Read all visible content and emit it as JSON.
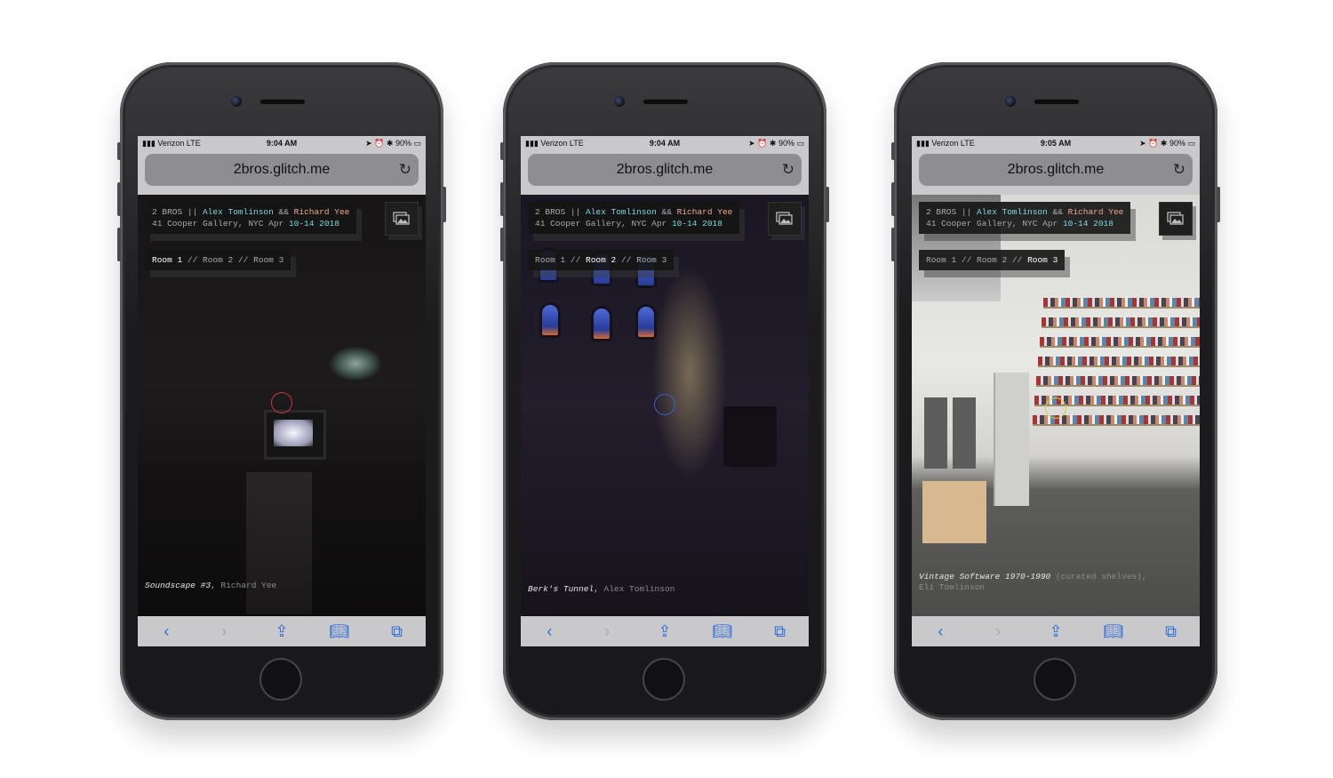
{
  "phones": [
    {
      "status": {
        "carrier": "Verizon",
        "network": "LTE",
        "time": "9:04 AM",
        "battery": "90%"
      },
      "url": "2bros.glitch.me",
      "info": {
        "prefix": "2 BROS || ",
        "artist1": "Alex Tomlinson",
        "amp": " && ",
        "artist2": "Richard Yee",
        "venue": "41 Cooper Gallery, NYC Apr ",
        "dates": "10-14 2018"
      },
      "rooms": {
        "r1": "Room 1",
        "sep1": " // ",
        "r2": "Room 2",
        "sep2": " // ",
        "r3": "Room 3",
        "active": 1
      },
      "caption": {
        "title": "Soundscape #3",
        "sep": ", ",
        "artist": "Richard Yee"
      },
      "reticle_color": "#d0343a"
    },
    {
      "status": {
        "carrier": "Verizon",
        "network": "LTE",
        "time": "9:04 AM",
        "battery": "90%"
      },
      "url": "2bros.glitch.me",
      "info": {
        "prefix": "2 BROS || ",
        "artist1": "Alex Tomlinson",
        "amp": " && ",
        "artist2": "Richard Yee",
        "venue": "41 Cooper Gallery, NYC Apr ",
        "dates": "10-14 2018"
      },
      "rooms": {
        "r1": "Room 1",
        "sep1": " // ",
        "r2": "Room 2",
        "sep2": " // ",
        "r3": "Room 3",
        "active": 2
      },
      "caption": {
        "title": "Berk's Tunnel",
        "sep": ", ",
        "artist": "Alex Tomlinson"
      },
      "reticle_color": "#3e5fc4"
    },
    {
      "status": {
        "carrier": "Verizon",
        "network": "LTE",
        "time": "9:05 AM",
        "battery": "90%"
      },
      "url": "2bros.glitch.me",
      "info": {
        "prefix": "2 BROS || ",
        "artist1": "Alex Tomlinson",
        "amp": " && ",
        "artist2": "Richard Yee",
        "venue": "41 Cooper Gallery, NYC Apr ",
        "dates": "10-14 2018"
      },
      "rooms": {
        "r1": "Room 1",
        "sep1": " // ",
        "r2": "Room 2",
        "sep2": " // ",
        "r3": "Room 3",
        "active": 3
      },
      "caption": {
        "title": "Vintage Software 1970-1990",
        "note": " (curated shelves),",
        "artist": "Eli Tomlinson"
      },
      "reticle_color": "#d4cf3a"
    }
  ],
  "toolbar_icons": [
    "back-icon",
    "forward-icon",
    "share-icon",
    "bookmarks-icon",
    "tabs-icon"
  ],
  "colors": {
    "artist1": "#7fd9e1",
    "artist2": "#f2a68d",
    "ios_blue": "#2f6ed8"
  }
}
